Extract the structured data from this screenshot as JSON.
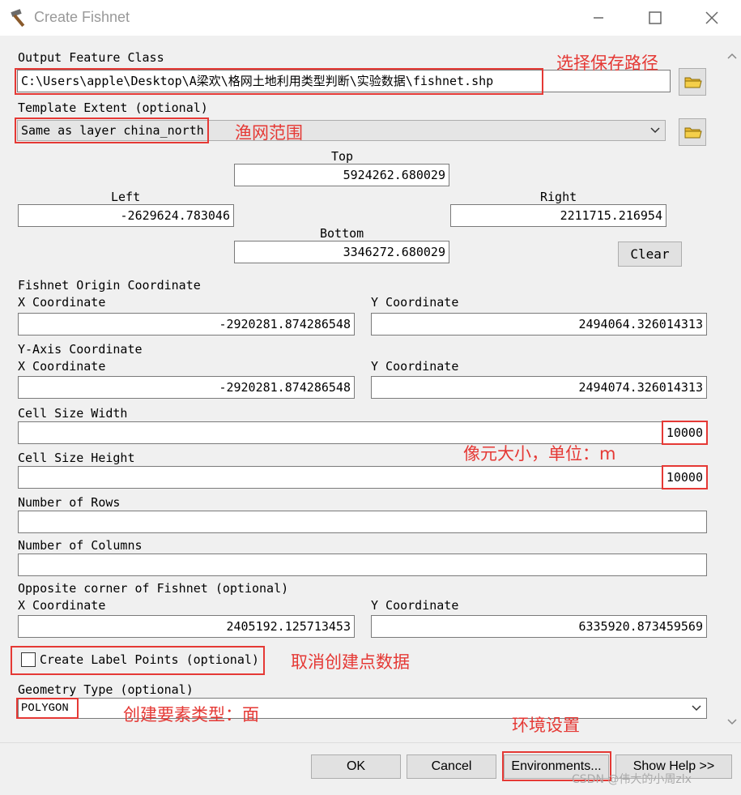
{
  "window": {
    "title": "Create Fishnet",
    "controls": [
      "minimize",
      "maximize",
      "close"
    ]
  },
  "output_feature_class": {
    "label": "Output Feature Class",
    "value": "C:\\Users\\apple\\Desktop\\A梁欢\\格网土地利用类型判断\\实验数据\\fishnet.shp"
  },
  "template_extent": {
    "label": "Template Extent (optional)",
    "value": "Same as layer china_north",
    "top_label": "Top",
    "top": "5924262.680029",
    "left_label": "Left",
    "left": "-2629624.783046",
    "right_label": "Right",
    "right": "2211715.216954",
    "bottom_label": "Bottom",
    "bottom": "3346272.680029",
    "clear_label": "Clear"
  },
  "origin": {
    "label": "Fishnet Origin Coordinate",
    "x_label": "X Coordinate",
    "x": "-2920281.874286548",
    "y_label": "Y Coordinate",
    "y": "2494064.326014313"
  },
  "y_axis": {
    "label": "Y-Axis Coordinate",
    "x_label": "X Coordinate",
    "x": "-2920281.874286548",
    "y_label": "Y Coordinate",
    "y": "2494074.326014313"
  },
  "cell_width": {
    "label": "Cell Size Width",
    "value": "10000"
  },
  "cell_height": {
    "label": "Cell Size Height",
    "value": "10000"
  },
  "rows": {
    "label": "Number of Rows",
    "value": ""
  },
  "columns": {
    "label": "Number of Columns",
    "value": ""
  },
  "opposite": {
    "label": "Opposite corner of Fishnet (optional)",
    "x_label": "X Coordinate",
    "x": "2405192.125713453",
    "y_label": "Y Coordinate",
    "y": "6335920.873459569"
  },
  "label_points": {
    "label": "Create Label Points (optional)",
    "checked": false
  },
  "geometry_type": {
    "label": "Geometry Type (optional)",
    "value": "POLYGON"
  },
  "buttons": {
    "ok": "OK",
    "cancel": "Cancel",
    "environments": "Environments...",
    "show_help": "Show Help >>"
  },
  "annotations": {
    "save_path": "选择保存路径",
    "fishnet_extent": "渔网范围",
    "cell_size": "像元大小，单位：m",
    "cancel_points": "取消创建点数据",
    "geometry": "创建要素类型：面",
    "environment": "环境设置"
  },
  "watermark": "CSDN @伟大的小周zlx",
  "colors": {
    "annotation": "#e53935",
    "panel": "#f0f0f0"
  }
}
